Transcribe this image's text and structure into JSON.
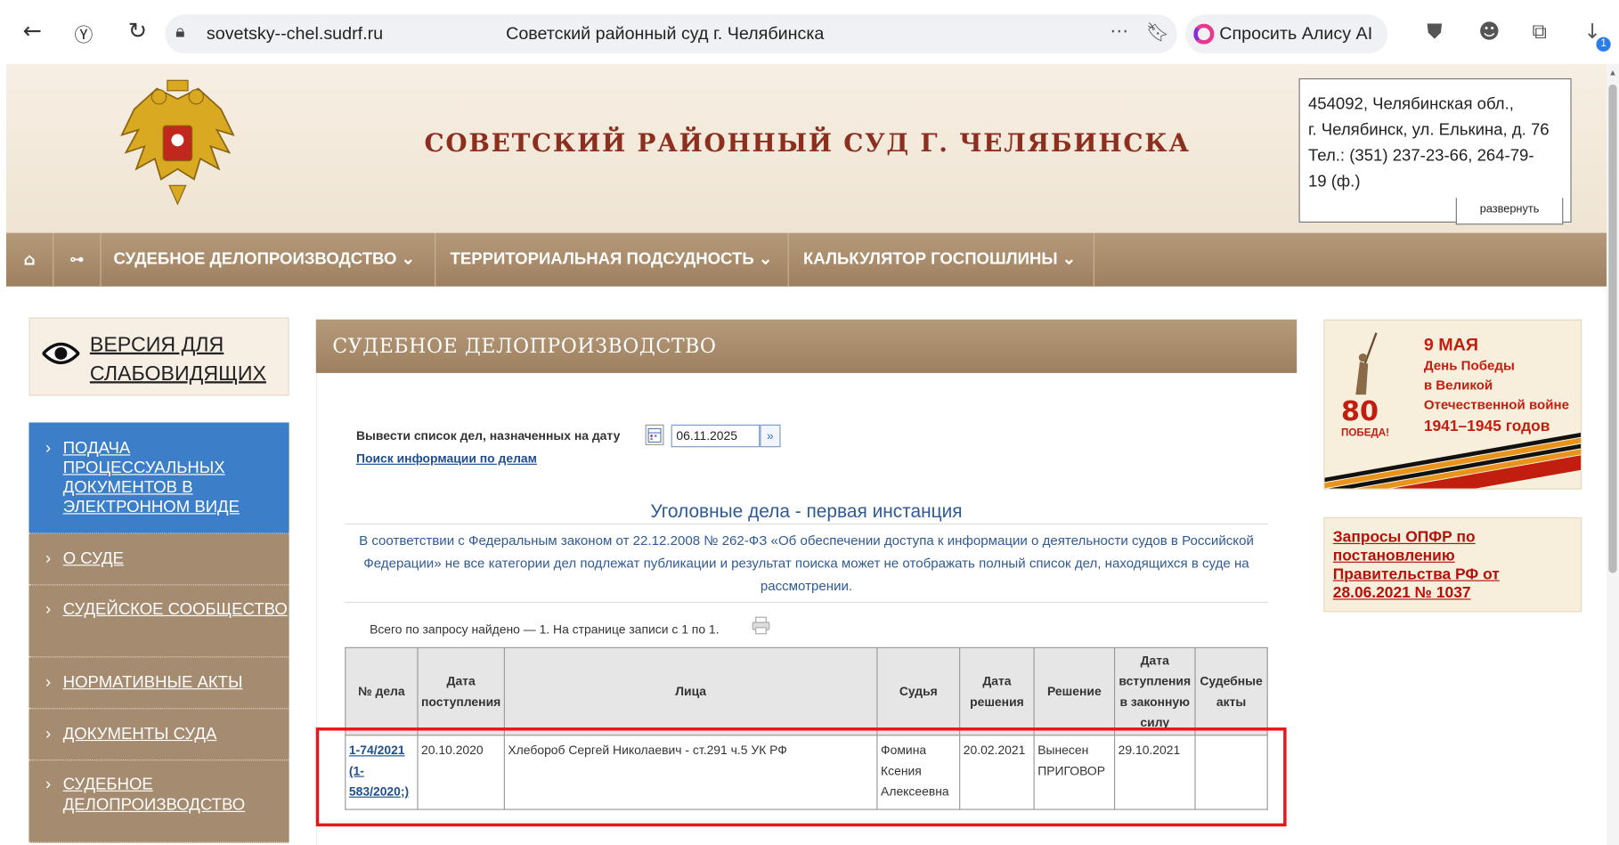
{
  "browser": {
    "domain": "sovetsky--chel.sudrf.ru",
    "page_title": "Советский районный суд г. Челябинска",
    "alice_label": "Спросить Алису AI",
    "download_badge": "1"
  },
  "header": {
    "court_name": "СОВЕТСКИЙ РАЙОННЫЙ СУД Г. ЧЕЛЯБИНСКА",
    "address_lines": [
      "454092, Челябинская обл.,",
      "г. Челябинск, ул. Елькина, д. 76",
      "Тел.: (351) 237-23-66, 264-79-",
      "19 (ф.)"
    ],
    "expand_label": "развернуть"
  },
  "nav": {
    "items": [
      "СУДЕБНОЕ ДЕЛОПРОИЗВОДСТВО ⌄",
      "ТЕРРИТОРИАЛЬНАЯ ПОДСУДНОСТЬ ⌄",
      "КАЛЬКУЛЯТОР ГОСПОШЛИНЫ ⌄"
    ]
  },
  "sidebar": {
    "vision_label": "ВЕРСИЯ ДЛЯ СЛАБОВИДЯЩИХ",
    "items": [
      {
        "label": "ПОДАЧА ПРОЦЕССУАЛЬНЫХ ДОКУМЕНТОВ В ЭЛЕКТРОННОМ ВИДЕ"
      },
      {
        "label": "О СУДЕ"
      },
      {
        "label": "СУДЕЙСКОЕ СООБЩЕСТВО"
      },
      {
        "label": "НОРМАТИВНЫЕ АКТЫ"
      },
      {
        "label": "ДОКУМЕНТЫ СУДА"
      },
      {
        "label": "СУДЕБНОЕ ДЕЛОПРОИЗВОДСТВО"
      }
    ]
  },
  "main": {
    "heading": "СУДЕБНОЕ ДЕЛОПРОИЗВОДСТВО",
    "date_label": "Вывести список дел, назначенных на дату",
    "date_value": "06.11.2025",
    "search_link": "Поиск информации по делам",
    "section_title": "Уголовные дела - первая инстанция",
    "section_note": "В соответствии с Федеральным законом от 22.12.2008 № 262-ФЗ «Об обеспечении доступа к информации о деятельности судов в Российской Федерации» не все категории дел подлежат публикации и результат поиска может не отображать полный список дел, находящихся в суде на рассмотрении.",
    "found_text": "Всего по запросу найдено — 1. На странице записи с 1 по 1.",
    "table": {
      "headers": [
        "№ дела",
        "Дата поступления",
        "Лица",
        "Судья",
        "Дата решения",
        "Решение",
        "Дата вступления в законную силу",
        "Судебные акты"
      ],
      "rows": [
        {
          "case_no": "1-74/2021 (1-583/2020;)",
          "received": "20.10.2020",
          "persons": "Хлебороб Сергей Николаевич - ст.291 ч.5 УК РФ",
          "judge": "Фомина Ксения Алексеевна",
          "decision_date": "20.02.2021",
          "decision": "Вынесен ПРИГОВОР",
          "effective_date": "29.10.2021",
          "acts": ""
        }
      ]
    }
  },
  "right": {
    "banner": {
      "line1": "9 МАЯ",
      "line2": "День Победы",
      "line3": "в Великой",
      "line4": "Отечественной войне",
      "line5": "1941–1945 годов",
      "num": "80",
      "pobeda": "ПОБЕДА!"
    },
    "opfr_link": "Запросы ОПФР по постановлению Правительства РФ от 28.06.2021 № 1037"
  },
  "colors": {
    "court_red": "#8c2f1f",
    "nav_brown": "#a58b70",
    "active_blue": "#3c7fc8",
    "highlight_red": "#e8151b",
    "link_blue": "#1f4f8f"
  }
}
